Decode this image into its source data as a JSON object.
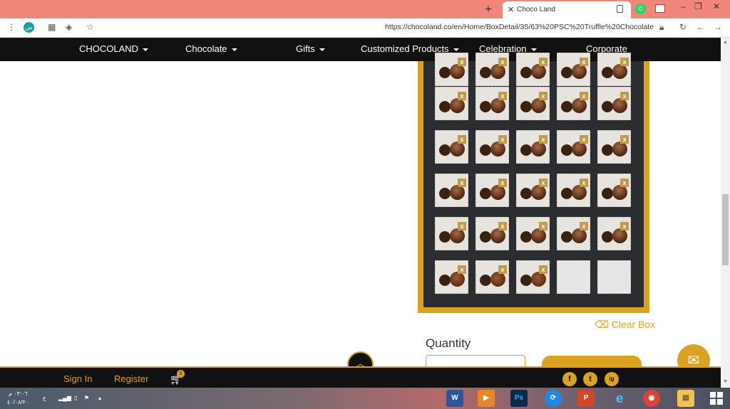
{
  "browser": {
    "tab_title": "Choco Land",
    "new_tab_symbol": "+",
    "tab_close_symbol": "✕",
    "url": "https://chocoland.co/en/Home/BoxDetail/35/63%20PSC%20Truffle%20Chocolate",
    "window_controls": [
      "–",
      "❐",
      "✕"
    ]
  },
  "nav": {
    "items": [
      {
        "label": "CHOCOLAND",
        "dropdown": true
      },
      {
        "label": "Chocolate",
        "dropdown": true
      },
      {
        "label": "Gifts",
        "dropdown": true
      },
      {
        "label": "Customized Products",
        "dropdown": true
      },
      {
        "label": "Celebration",
        "dropdown": true
      },
      {
        "label": "Corporate",
        "dropdown": false
      }
    ]
  },
  "box": {
    "remove_symbol": "x",
    "rows": [
      [
        "filled",
        "filled",
        "filled",
        "filled",
        "filled"
      ],
      [
        "filled",
        "filled",
        "filled",
        "filled",
        "filled"
      ],
      [
        "filled",
        "filled",
        "filled",
        "filled",
        "filled"
      ],
      [
        "filled",
        "filled",
        "filled",
        "filled",
        "filled"
      ],
      [
        "filled",
        "filled",
        "filled",
        "filled",
        "filled"
      ],
      [
        "filled-plain",
        "filled-plain",
        "filled-plain",
        "empty",
        "empty"
      ]
    ],
    "clear_label": "Clear Box",
    "quantity_label": "Quantity"
  },
  "footer": {
    "sign_in": "Sign In",
    "register": "Register",
    "cart_count": "0",
    "social": [
      "f",
      "t",
      "ig"
    ]
  },
  "taskbar": {
    "time": "٠٣:٠٦ م",
    "date": "٤٠/٠٨/٢٠",
    "lang": "ع",
    "apps": [
      "W",
      "▶",
      "Ps",
      "⟳",
      "P",
      "e",
      "◉",
      "▤"
    ]
  },
  "colors": {
    "accent": "#d9a221",
    "tabstrip": "#f2867a",
    "nav_bg": "#111111",
    "box_inner": "#2b2d30"
  }
}
